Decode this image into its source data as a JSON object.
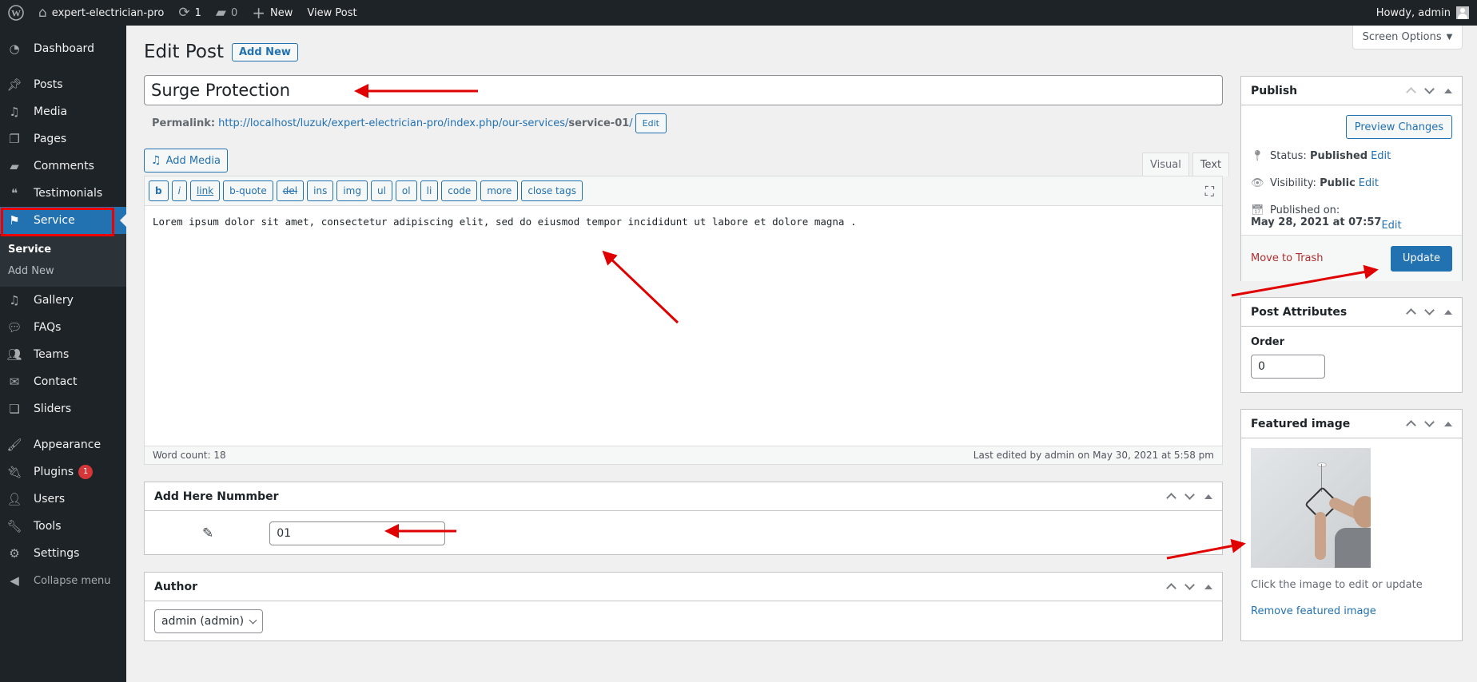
{
  "admin_bar": {
    "wp_logo": "wordpress-logo",
    "site_name": "expert-electrician-pro",
    "updates_count": "1",
    "comments_count": "0",
    "new_label": "New",
    "view_post_label": "View Post",
    "howdy": "Howdy, admin"
  },
  "sidebar": {
    "items": [
      {
        "label": "Dashboard",
        "icon": "dashboard-icon"
      },
      {
        "label": "Posts",
        "icon": "pin-icon"
      },
      {
        "label": "Media",
        "icon": "media-icon"
      },
      {
        "label": "Pages",
        "icon": "pages-icon"
      },
      {
        "label": "Comments",
        "icon": "comment-icon"
      },
      {
        "label": "Testimonials",
        "icon": "testimonials-icon"
      },
      {
        "label": "Service",
        "icon": "graduation-cap-icon",
        "current": true
      },
      {
        "label": "Gallery",
        "icon": "gallery-icon"
      },
      {
        "label": "FAQs",
        "icon": "faq-icon"
      },
      {
        "label": "Teams",
        "icon": "groups-icon"
      },
      {
        "label": "Contact",
        "icon": "email-icon"
      },
      {
        "label": "Sliders",
        "icon": "slides-icon"
      },
      {
        "label": "Appearance",
        "icon": "brush-icon"
      },
      {
        "label": "Plugins",
        "icon": "plugin-icon",
        "badge": "1"
      },
      {
        "label": "Users",
        "icon": "user-icon"
      },
      {
        "label": "Tools",
        "icon": "wrench-icon"
      },
      {
        "label": "Settings",
        "icon": "settings-icon"
      }
    ],
    "submenu": [
      {
        "label": "Service",
        "current": true
      },
      {
        "label": "Add New"
      }
    ],
    "collapse_label": "Collapse menu"
  },
  "screen_options_label": "Screen Options",
  "page": {
    "title": "Edit Post",
    "add_new_label": "Add New"
  },
  "post": {
    "title": "Surge Protection",
    "permalink_label": "Permalink:",
    "permalink_base": "http://localhost/luzuk/expert-electrician-pro/index.php/our-services/",
    "permalink_slug": "service-01",
    "permalink_trailing": "/",
    "permalink_edit_label": "Edit"
  },
  "editor": {
    "add_media_label": "Add Media",
    "tabs": [
      {
        "label": "Visual"
      },
      {
        "label": "Text",
        "active": true
      }
    ],
    "quicktags": [
      "b",
      "i",
      "link",
      "b-quote",
      "del",
      "ins",
      "img",
      "ul",
      "ol",
      "li",
      "code",
      "more",
      "close tags"
    ],
    "content": "Lorem ipsum dolor sit amet, consectetur adipiscing elit, sed do eiusmod tempor incididunt ut labore et dolore magna .",
    "word_count": "Word count: 18",
    "last_edited": "Last edited by admin on May 30, 2021 at 5:58 pm"
  },
  "number_box": {
    "title": "Add Here Nummber",
    "value": "01"
  },
  "author_box": {
    "title": "Author",
    "selected": "admin (admin)"
  },
  "publish_box": {
    "title": "Publish",
    "preview_label": "Preview Changes",
    "status_label": "Status:",
    "status_value": "Published",
    "visibility_label": "Visibility:",
    "visibility_value": "Public",
    "published_on_label": "Published on:",
    "published_on_value": "May 28, 2021 at 07:57",
    "edit_label": "Edit",
    "trash_label": "Move to Trash",
    "update_label": "Update"
  },
  "attributes_box": {
    "title": "Post Attributes",
    "order_label": "Order",
    "order_value": "0"
  },
  "featured_box": {
    "title": "Featured image",
    "caption": "Click the image to edit or update",
    "remove_label": "Remove featured image"
  },
  "annotations": {
    "arrow_color": "#e00000",
    "highlight_color": "#e00000"
  }
}
